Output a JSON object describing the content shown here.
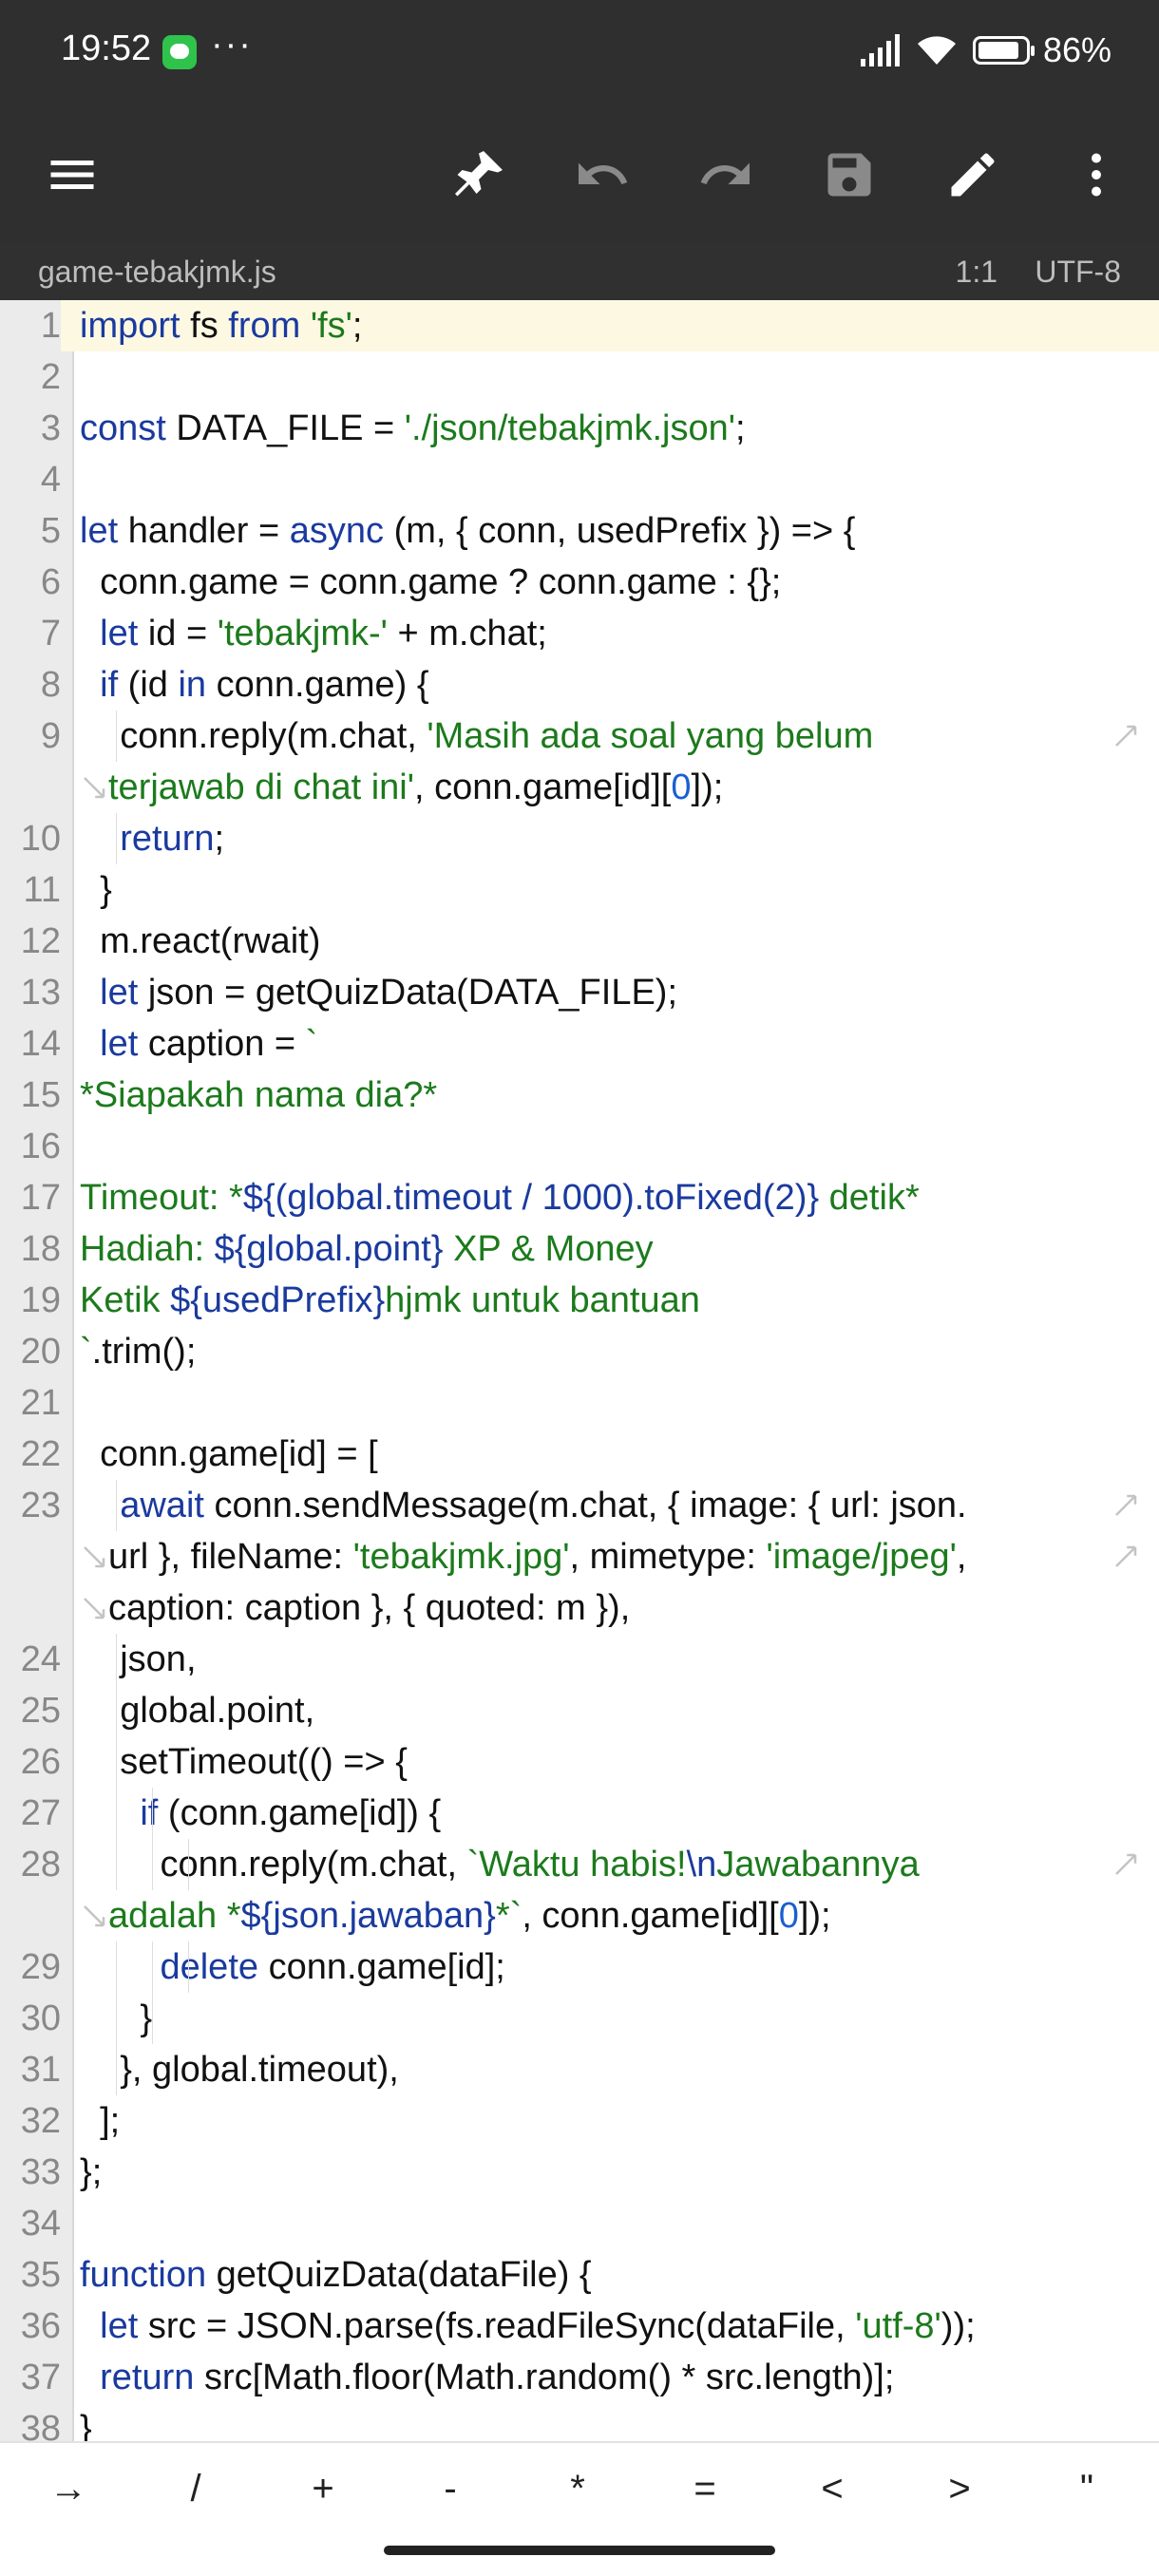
{
  "status_bar": {
    "time": "19:52",
    "dots": "···",
    "battery": "86%"
  },
  "toolbar": {
    "menu": "menu-icon",
    "pin": "pin-icon",
    "undo": "undo-icon",
    "redo": "redo-icon",
    "save": "save-icon",
    "edit": "edit-icon",
    "more": "more-vert-icon"
  },
  "file": {
    "name": "game-tebakjmk.js",
    "cursor": "1:1",
    "encoding": "UTF-8"
  },
  "code": [
    {
      "n": "1",
      "t": "import fs from 'fs';"
    },
    {
      "n": "2",
      "t": ""
    },
    {
      "n": "3",
      "t": "const DATA_FILE = './json/tebakjmk.json';"
    },
    {
      "n": "4",
      "t": ""
    },
    {
      "n": "5",
      "t": "let handler = async (m, { conn, usedPrefix }) => {"
    },
    {
      "n": "6",
      "t": "  conn.game = conn.game ? conn.game : {};"
    },
    {
      "n": "7",
      "t": "  let id = 'tebakjmk-' + m.chat;"
    },
    {
      "n": "8",
      "t": "  if (id in conn.game) {"
    },
    {
      "n": "9",
      "t": "    conn.reply(m.chat, 'Masih ada soal yang belum"
    },
    {
      "n": "",
      "t": "terjawab di chat ini', conn.game[id][0]);"
    },
    {
      "n": "10",
      "t": "    return;"
    },
    {
      "n": "11",
      "t": "  }"
    },
    {
      "n": "12",
      "t": "  m.react(rwait)"
    },
    {
      "n": "13",
      "t": "  let json = getQuizData(DATA_FILE);"
    },
    {
      "n": "14",
      "t": "  let caption = `"
    },
    {
      "n": "15",
      "t": "*Siapakah nama dia?*"
    },
    {
      "n": "16",
      "t": ""
    },
    {
      "n": "17",
      "t": "Timeout: *${(global.timeout / 1000).toFixed(2)} detik*"
    },
    {
      "n": "18",
      "t": "Hadiah: ${global.point} XP & Money"
    },
    {
      "n": "19",
      "t": "Ketik ${usedPrefix}hjmk untuk bantuan"
    },
    {
      "n": "20",
      "t": "`.trim();"
    },
    {
      "n": "21",
      "t": ""
    },
    {
      "n": "22",
      "t": "  conn.game[id] = ["
    },
    {
      "n": "23",
      "t": "    await conn.sendMessage(m.chat, { image: { url: json."
    },
    {
      "n": "",
      "t": "url }, fileName: 'tebakjmk.jpg', mimetype: 'image/jpeg',"
    },
    {
      "n": "",
      "t": "caption: caption }, { quoted: m }),"
    },
    {
      "n": "24",
      "t": "    json,"
    },
    {
      "n": "25",
      "t": "    global.point,"
    },
    {
      "n": "26",
      "t": "    setTimeout(() => {"
    },
    {
      "n": "27",
      "t": "      if (conn.game[id]) {"
    },
    {
      "n": "28",
      "t": "        conn.reply(m.chat, `Waktu habis!\\nJawabannya"
    },
    {
      "n": "",
      "t": "adalah *${json.jawaban}*`, conn.game[id][0]);"
    },
    {
      "n": "29",
      "t": "        delete conn.game[id];"
    },
    {
      "n": "30",
      "t": "      }"
    },
    {
      "n": "31",
      "t": "    }, global.timeout),"
    },
    {
      "n": "32",
      "t": "  ];"
    },
    {
      "n": "33",
      "t": "};"
    },
    {
      "n": "34",
      "t": ""
    },
    {
      "n": "35",
      "t": "function getQuizData(dataFile) {"
    },
    {
      "n": "36",
      "t": "  let src = JSON.parse(fs.readFileSync(dataFile, 'utf-8'));"
    },
    {
      "n": "37",
      "t": "  return src[Math.floor(Math.random() * src.length)];"
    },
    {
      "n": "38",
      "t": "}"
    }
  ],
  "symbols": [
    "→",
    "/",
    "+",
    "-",
    "*",
    "=",
    "<",
    ">",
    "\""
  ]
}
